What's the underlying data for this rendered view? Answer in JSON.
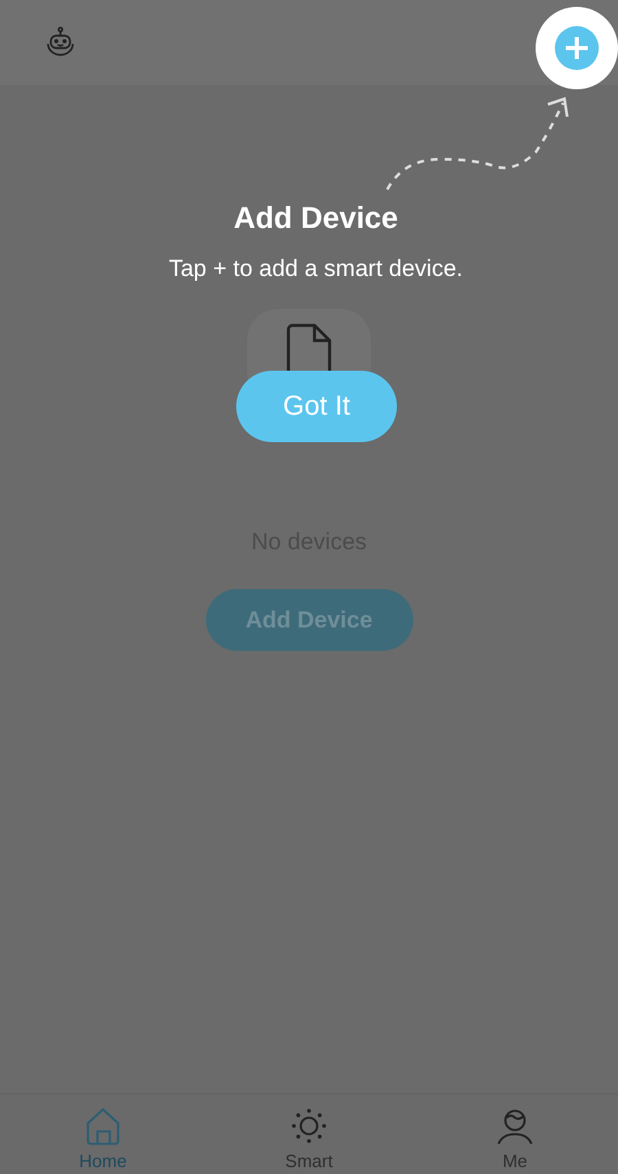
{
  "empty_state": {
    "message": "No devices",
    "button": "Add Device"
  },
  "tabs": [
    {
      "label": "Home",
      "selected": true
    },
    {
      "label": "Smart",
      "selected": false
    },
    {
      "label": "Me",
      "selected": false
    }
  ],
  "coach_mark": {
    "title": "Add Device",
    "text": "Tap + to add a smart device.",
    "button": "Got It"
  }
}
